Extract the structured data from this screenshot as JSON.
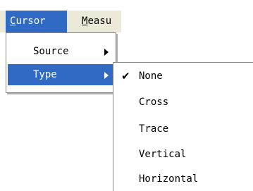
{
  "menubar": {
    "cursor_label": "Cursor",
    "measure_label": "Measu"
  },
  "cursor_menu": {
    "items": [
      {
        "label": "Source"
      },
      {
        "label": "Type"
      }
    ]
  },
  "type_submenu": {
    "items": [
      {
        "label": "None",
        "checked": true
      },
      {
        "label": "Cross"
      },
      {
        "label": "Trace"
      },
      {
        "label": "Vertical"
      },
      {
        "label": "Horizontal"
      }
    ],
    "check_glyph": "✔"
  },
  "colors": {
    "highlight": "#316ac5",
    "menubar_bg": "#ece9d8"
  }
}
